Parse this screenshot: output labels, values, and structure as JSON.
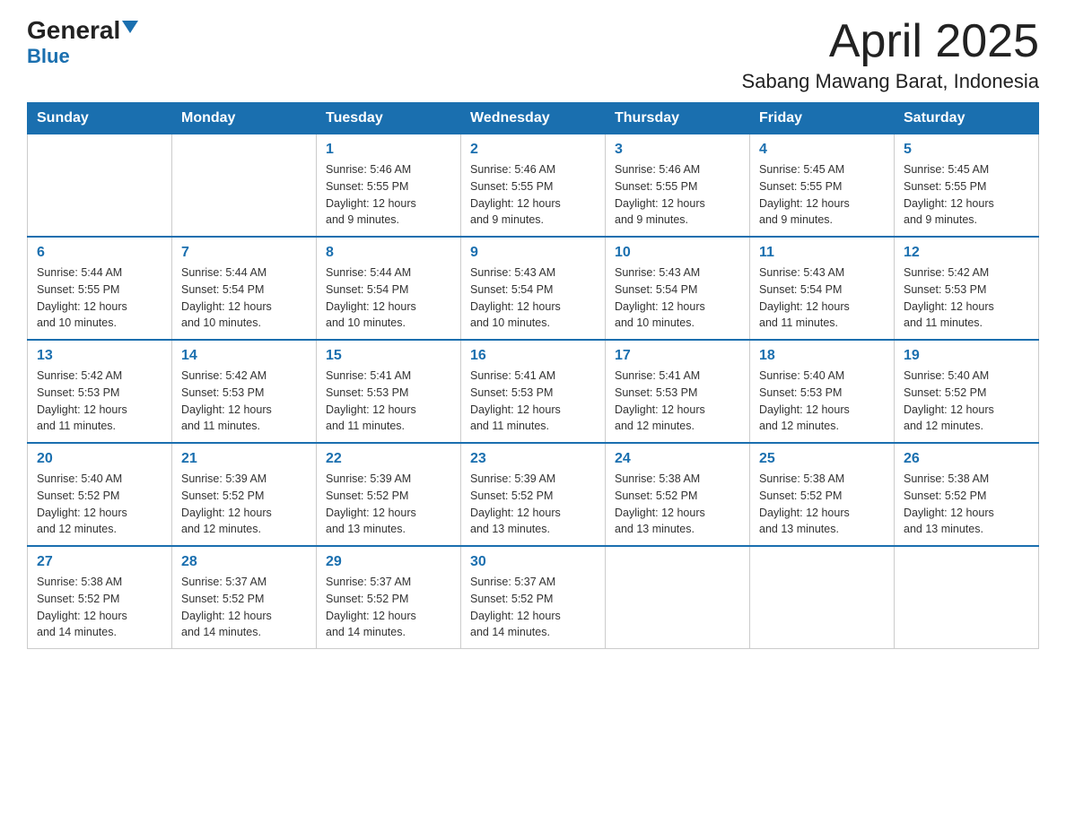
{
  "logo": {
    "general": "General",
    "blue": "Blue"
  },
  "title": "April 2025",
  "subtitle": "Sabang Mawang Barat, Indonesia",
  "days_of_week": [
    "Sunday",
    "Monday",
    "Tuesday",
    "Wednesday",
    "Thursday",
    "Friday",
    "Saturday"
  ],
  "weeks": [
    [
      {
        "day": "",
        "info": ""
      },
      {
        "day": "",
        "info": ""
      },
      {
        "day": "1",
        "info": "Sunrise: 5:46 AM\nSunset: 5:55 PM\nDaylight: 12 hours\nand 9 minutes."
      },
      {
        "day": "2",
        "info": "Sunrise: 5:46 AM\nSunset: 5:55 PM\nDaylight: 12 hours\nand 9 minutes."
      },
      {
        "day": "3",
        "info": "Sunrise: 5:46 AM\nSunset: 5:55 PM\nDaylight: 12 hours\nand 9 minutes."
      },
      {
        "day": "4",
        "info": "Sunrise: 5:45 AM\nSunset: 5:55 PM\nDaylight: 12 hours\nand 9 minutes."
      },
      {
        "day": "5",
        "info": "Sunrise: 5:45 AM\nSunset: 5:55 PM\nDaylight: 12 hours\nand 9 minutes."
      }
    ],
    [
      {
        "day": "6",
        "info": "Sunrise: 5:44 AM\nSunset: 5:55 PM\nDaylight: 12 hours\nand 10 minutes."
      },
      {
        "day": "7",
        "info": "Sunrise: 5:44 AM\nSunset: 5:54 PM\nDaylight: 12 hours\nand 10 minutes."
      },
      {
        "day": "8",
        "info": "Sunrise: 5:44 AM\nSunset: 5:54 PM\nDaylight: 12 hours\nand 10 minutes."
      },
      {
        "day": "9",
        "info": "Sunrise: 5:43 AM\nSunset: 5:54 PM\nDaylight: 12 hours\nand 10 minutes."
      },
      {
        "day": "10",
        "info": "Sunrise: 5:43 AM\nSunset: 5:54 PM\nDaylight: 12 hours\nand 10 minutes."
      },
      {
        "day": "11",
        "info": "Sunrise: 5:43 AM\nSunset: 5:54 PM\nDaylight: 12 hours\nand 11 minutes."
      },
      {
        "day": "12",
        "info": "Sunrise: 5:42 AM\nSunset: 5:53 PM\nDaylight: 12 hours\nand 11 minutes."
      }
    ],
    [
      {
        "day": "13",
        "info": "Sunrise: 5:42 AM\nSunset: 5:53 PM\nDaylight: 12 hours\nand 11 minutes."
      },
      {
        "day": "14",
        "info": "Sunrise: 5:42 AM\nSunset: 5:53 PM\nDaylight: 12 hours\nand 11 minutes."
      },
      {
        "day": "15",
        "info": "Sunrise: 5:41 AM\nSunset: 5:53 PM\nDaylight: 12 hours\nand 11 minutes."
      },
      {
        "day": "16",
        "info": "Sunrise: 5:41 AM\nSunset: 5:53 PM\nDaylight: 12 hours\nand 11 minutes."
      },
      {
        "day": "17",
        "info": "Sunrise: 5:41 AM\nSunset: 5:53 PM\nDaylight: 12 hours\nand 12 minutes."
      },
      {
        "day": "18",
        "info": "Sunrise: 5:40 AM\nSunset: 5:53 PM\nDaylight: 12 hours\nand 12 minutes."
      },
      {
        "day": "19",
        "info": "Sunrise: 5:40 AM\nSunset: 5:52 PM\nDaylight: 12 hours\nand 12 minutes."
      }
    ],
    [
      {
        "day": "20",
        "info": "Sunrise: 5:40 AM\nSunset: 5:52 PM\nDaylight: 12 hours\nand 12 minutes."
      },
      {
        "day": "21",
        "info": "Sunrise: 5:39 AM\nSunset: 5:52 PM\nDaylight: 12 hours\nand 12 minutes."
      },
      {
        "day": "22",
        "info": "Sunrise: 5:39 AM\nSunset: 5:52 PM\nDaylight: 12 hours\nand 13 minutes."
      },
      {
        "day": "23",
        "info": "Sunrise: 5:39 AM\nSunset: 5:52 PM\nDaylight: 12 hours\nand 13 minutes."
      },
      {
        "day": "24",
        "info": "Sunrise: 5:38 AM\nSunset: 5:52 PM\nDaylight: 12 hours\nand 13 minutes."
      },
      {
        "day": "25",
        "info": "Sunrise: 5:38 AM\nSunset: 5:52 PM\nDaylight: 12 hours\nand 13 minutes."
      },
      {
        "day": "26",
        "info": "Sunrise: 5:38 AM\nSunset: 5:52 PM\nDaylight: 12 hours\nand 13 minutes."
      }
    ],
    [
      {
        "day": "27",
        "info": "Sunrise: 5:38 AM\nSunset: 5:52 PM\nDaylight: 12 hours\nand 14 minutes."
      },
      {
        "day": "28",
        "info": "Sunrise: 5:37 AM\nSunset: 5:52 PM\nDaylight: 12 hours\nand 14 minutes."
      },
      {
        "day": "29",
        "info": "Sunrise: 5:37 AM\nSunset: 5:52 PM\nDaylight: 12 hours\nand 14 minutes."
      },
      {
        "day": "30",
        "info": "Sunrise: 5:37 AM\nSunset: 5:52 PM\nDaylight: 12 hours\nand 14 minutes."
      },
      {
        "day": "",
        "info": ""
      },
      {
        "day": "",
        "info": ""
      },
      {
        "day": "",
        "info": ""
      }
    ]
  ]
}
